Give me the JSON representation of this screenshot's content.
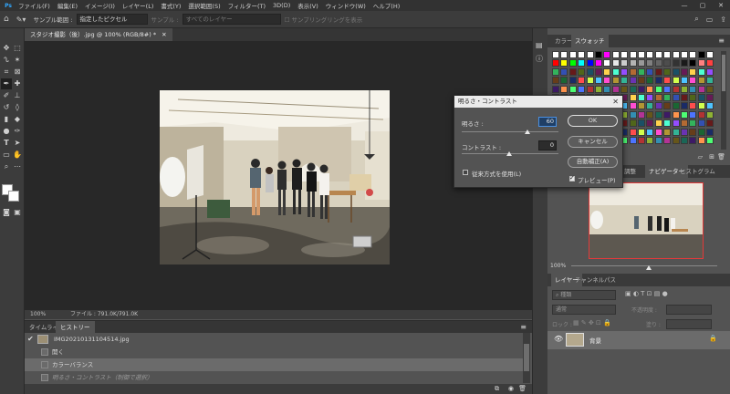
{
  "menubar": {
    "logo": "Ps",
    "items": [
      "ファイル(F)",
      "編集(E)",
      "イメージ(I)",
      "レイヤー(L)",
      "書式(Y)",
      "選択範囲(S)",
      "フィルター(T)",
      "3D(D)",
      "表示(V)",
      "ウィンドウ(W)",
      "ヘルプ(H)"
    ],
    "window_controls": [
      "—",
      "▢",
      "✕"
    ]
  },
  "options_bar": {
    "sample_label": "サンプル範囲 :",
    "sample_value": "指定したピクセル",
    "sample2_label": "サンプル :",
    "sample2_value": "すべてのレイヤー",
    "show_ring_label": "サンプリングリングを表示"
  },
  "document": {
    "tab_title": "スタジオ撮影（後）.jpg @ 100% (RGB/8#) *",
    "tab_close": "✕",
    "zoom": "100%",
    "file_info": "ファイル : 791.0K/791.0K"
  },
  "history_panel": {
    "tabs": [
      "タイムライン",
      "ヒストリー"
    ],
    "snapshot": "IMG20210131104514.jpg",
    "states": [
      "開く",
      "カラーバランス",
      "明るさ・コントラスト（制御で選択）"
    ]
  },
  "swatches_panel": {
    "tabs": [
      "カラー",
      "スウォッチ"
    ],
    "colors_row1": [
      "#ffffff",
      "#ffffff",
      "#ffffff",
      "#ffffff",
      "#ffffff",
      "#000000",
      "#ff00ff",
      "#ffffff",
      "#ffffff",
      "#ffffff",
      "#ffffff",
      "#ffffff",
      "#ffffff",
      "#ffffff",
      "#ffffff",
      "#ffffff",
      "#ffffff",
      "#000000",
      "#ffffff"
    ],
    "colors_row2": [
      "#ff0000",
      "#ffff00",
      "#00ff00",
      "#00ffff",
      "#0000ff",
      "#ff00ff",
      "#ffffff",
      "#e8e8e8",
      "#cccccc",
      "#b3b3b3",
      "#999999",
      "#808080",
      "#666666",
      "#4d4d4d",
      "#333333",
      "#1a1a1a",
      "#000000",
      "#ff8080",
      "#ff4040"
    ]
  },
  "dialog": {
    "title": "明るさ・コントラスト",
    "brightness_label": "明るさ :",
    "brightness_value": "60",
    "contrast_label": "コントラスト :",
    "contrast_value": "0",
    "legacy_label": "従来方式を使用(L)",
    "ok_label": "OK",
    "cancel_label": "キャンセル",
    "auto_label": "自動補正(A)",
    "preview_label": "プレビュー(P)",
    "preview_checked": true,
    "legacy_checked": false
  },
  "navigator_panel": {
    "tabs": [
      "調整",
      "ナビゲーター",
      "ヒストグラム"
    ],
    "zoom": "100%"
  },
  "layers_panel": {
    "tabs": [
      "レイヤー",
      "チャンネル",
      "パス"
    ],
    "filter_placeholder": "種類",
    "blend_mode": "通常",
    "opacity_label": "不透明度 :",
    "lock_label": "ロック :",
    "fill_label": "塗り :",
    "layer_name": "背景"
  },
  "accent": "#31a8ff"
}
